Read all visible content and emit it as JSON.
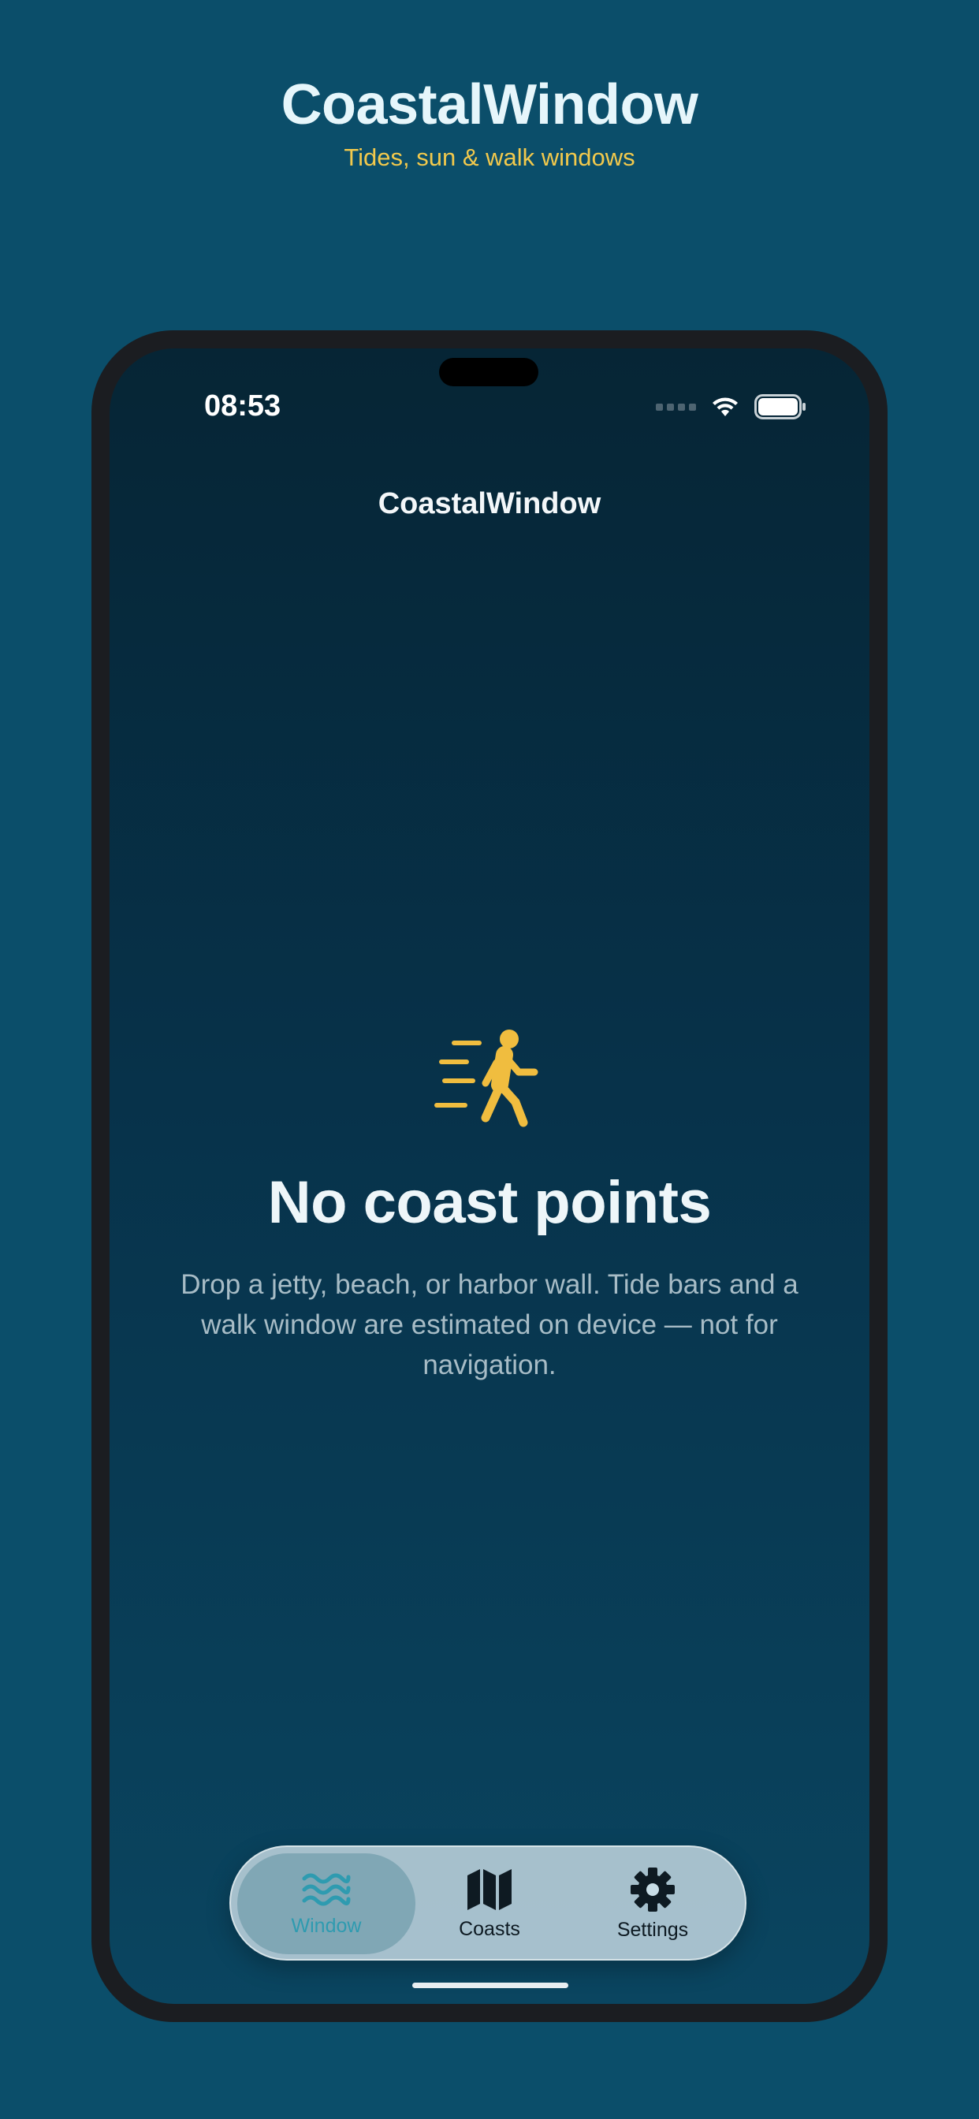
{
  "header": {
    "app_title": "CoastalWindow",
    "tagline": "Tides, sun & walk windows"
  },
  "status_bar": {
    "time": "08:53",
    "icons": [
      "cellular-signal-icon",
      "wifi-icon",
      "battery-icon"
    ]
  },
  "nav": {
    "title": "CoastalWindow"
  },
  "empty_state": {
    "icon": "walking-figure-icon",
    "title": "No coast points",
    "body": "Drop a jetty, beach, or harbor wall. Tide bars and a walk window are estimated on device — not for navigation."
  },
  "tab_bar": {
    "tabs": [
      {
        "label": "Window",
        "icon": "waves-icon",
        "selected": true
      },
      {
        "label": "Coasts",
        "icon": "map-icon",
        "selected": false
      },
      {
        "label": "Settings",
        "icon": "gear-icon",
        "selected": false
      }
    ]
  },
  "colors": {
    "background": "#0b4e6a",
    "accent": "#f2c94c",
    "selected_tab": "#2e9bb0"
  }
}
